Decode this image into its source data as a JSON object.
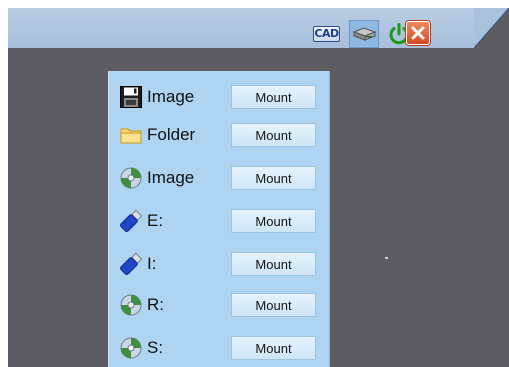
{
  "toolbar": {
    "cad_label": "CAD"
  },
  "drives": [
    {
      "icon": "floppy-disk-icon",
      "label": "Image",
      "button": "Mount"
    },
    {
      "icon": "folder-icon",
      "label": "Folder",
      "button": "Mount"
    },
    {
      "icon": "cd-image-icon",
      "label": "Image",
      "button": "Mount"
    },
    {
      "icon": "usb-drive-icon",
      "label": "E:",
      "button": "Mount"
    },
    {
      "icon": "usb-drive-icon",
      "label": "I:",
      "button": "Mount"
    },
    {
      "icon": "cd-drive-icon",
      "label": "R:",
      "button": "Mount"
    },
    {
      "icon": "cd-drive-icon",
      "label": "S:",
      "button": "Mount"
    }
  ],
  "colors": {
    "toolbar": "#b4c9e0",
    "desktop": "#5e5c63",
    "panel": "#aed4f1",
    "button": "#d9ecfa",
    "close": "#e0612f"
  }
}
